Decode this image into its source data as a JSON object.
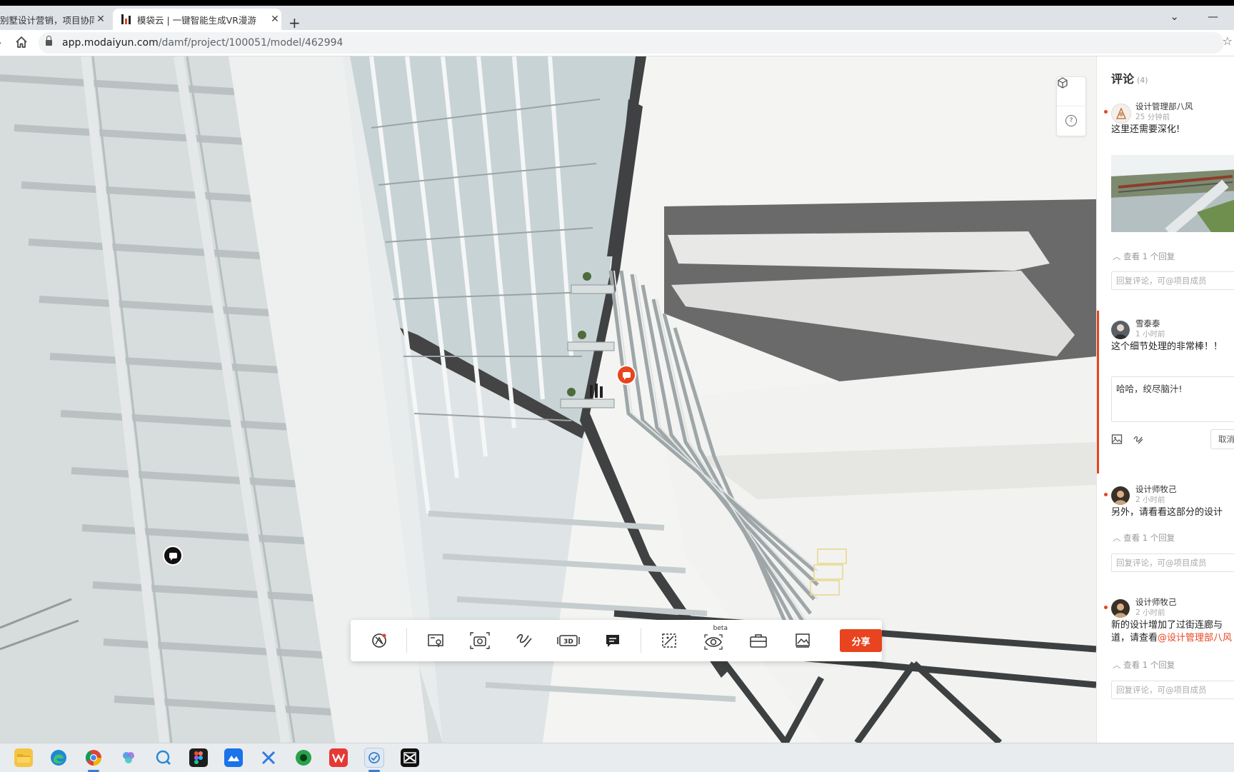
{
  "browser": {
    "tabs": [
      {
        "title": "别墅设计营销，项目协同",
        "active": false
      },
      {
        "title": "模袋云 | 一键智能生成VR漫游",
        "active": true
      }
    ],
    "new_tab": "+",
    "url_host": "app.modaiyun.com",
    "url_path": "/damf/project/100051/model/462994"
  },
  "viewport": {
    "side_tools": [
      "cube-view-icon",
      "help-icon"
    ],
    "help_label": "?",
    "markers": [
      {
        "name": "comment-marker-orange",
        "color": "#e8441f"
      },
      {
        "name": "comment-marker-dark",
        "color": "#111111"
      }
    ],
    "toolbar": {
      "buttons": [
        "panorama-icon",
        "map-pin-icon",
        "screenshot-icon",
        "measure-icon",
        "3d-view-icon",
        "comment-icon",
        "section-icon",
        "vr-view-icon",
        "toolbox-icon",
        "gallery-icon"
      ],
      "label_3d": "3D",
      "beta_label": "beta",
      "share_label": "分享",
      "share_color": "#e8441f"
    }
  },
  "comments": {
    "title": "评论",
    "count": "(4)",
    "items": [
      {
        "author": "设计管理部八风",
        "time": "25 分钟前",
        "text": "这里还需要深化!",
        "replies": "查看 1 个回复",
        "input_placeholder": "回复评论，可@项目成员"
      },
      {
        "author": "雪泰泰",
        "time": "1 小时前",
        "text": "这个细节处理的非常棒！！",
        "reply_draft": "哈哈，绞尽脑汁!",
        "cancel_label": "取消"
      },
      {
        "author": "设计师牧己",
        "time": "2 小时前",
        "text": "另外，请看看这部分的设计",
        "replies": "查看 1 个回复",
        "input_placeholder": "回复评论，可@项目成员"
      },
      {
        "author": "设计师牧己",
        "time": "2 小时前",
        "text_line1": "新的设计增加了过街连廊与",
        "text_line2": "道，请查看",
        "mention": "@设计管理部八风",
        "replies": "查看 1 个回复",
        "input_placeholder": "回复评论，可@项目成员"
      }
    ]
  },
  "taskbar": {
    "apps": [
      "file-explorer-icon",
      "edge-icon",
      "chrome-icon",
      "photos-icon",
      "feedback-icon",
      "figma-icon",
      "mail-icon",
      "x-app-icon",
      "green-app-icon",
      "wps-icon",
      "modaiyun-icon",
      "capcut-icon"
    ]
  },
  "accent_color": "#e8441f"
}
